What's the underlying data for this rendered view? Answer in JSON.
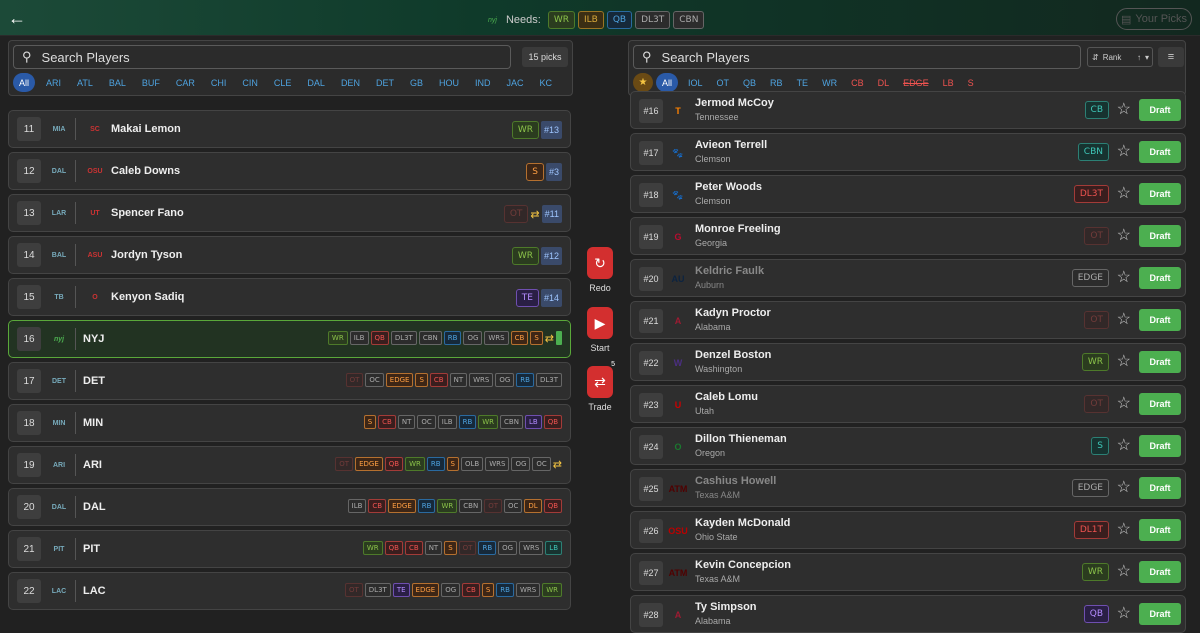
{
  "topbar": {
    "back_icon": "arrow-left-icon",
    "team_logo_text": "nyj",
    "needs_label": "Needs:",
    "needs": [
      {
        "label": "WR",
        "color": "g"
      },
      {
        "label": "ILB",
        "color": "y"
      },
      {
        "label": "QB",
        "color": "b"
      },
      {
        "label": "DL3T",
        "color": "gr"
      },
      {
        "label": "CBN",
        "color": "gr"
      }
    ],
    "your_picks_label": "Your Picks"
  },
  "left": {
    "search_placeholder": "Search Players",
    "picks_count": "15 picks",
    "team_filters": [
      "All",
      "ARI",
      "ATL",
      "BAL",
      "BUF",
      "CAR",
      "CHI",
      "CIN",
      "CLE",
      "DAL",
      "DEN",
      "DET",
      "GB",
      "HOU",
      "IND",
      "JAC",
      "KC"
    ],
    "picks": [
      {
        "num": "11",
        "team_logo": "MIA",
        "college_logo": "SC",
        "player": "Makai Lemon",
        "tags": [
          {
            "label": "WR",
            "color": "g"
          }
        ],
        "rank": "#13"
      },
      {
        "num": "12",
        "team_logo": "DAL",
        "college_logo": "OSU",
        "player": "Caleb Downs",
        "tags": [
          {
            "label": "S",
            "color": "o"
          }
        ],
        "rank": "#3"
      },
      {
        "num": "13",
        "team_logo": "LAR",
        "college_logo": "UT",
        "player": "Spencer Fano",
        "tags": [
          {
            "label": "OT",
            "color": "r",
            "dim": true
          }
        ],
        "rank": "#11",
        "trade": true
      },
      {
        "num": "14",
        "team_logo": "BAL",
        "college_logo": "ASU",
        "player": "Jordyn Tyson",
        "tags": [
          {
            "label": "WR",
            "color": "g"
          }
        ],
        "rank": "#12"
      },
      {
        "num": "15",
        "team_logo": "TB",
        "college_logo": "O",
        "player": "Kenyon Sadiq",
        "tags": [
          {
            "label": "TE",
            "color": "p"
          }
        ],
        "rank": "#14"
      }
    ],
    "current": {
      "num": "16",
      "team": "NYJ",
      "team_logo": "nyj",
      "tags": [
        {
          "label": "WR",
          "color": "g"
        },
        {
          "label": "ILB",
          "color": "gr"
        },
        {
          "label": "QB",
          "color": "r"
        },
        {
          "label": "DL3T",
          "color": "gr"
        },
        {
          "label": "CBN",
          "color": "gr"
        },
        {
          "label": "RB",
          "color": "b"
        },
        {
          "label": "OG",
          "color": "gr"
        },
        {
          "label": "WRS",
          "color": "gr"
        },
        {
          "label": "CB",
          "color": "o"
        },
        {
          "label": "S",
          "color": "o"
        }
      ]
    },
    "upcoming": [
      {
        "num": "17",
        "team": "DET",
        "team_logo": "DET",
        "tags": [
          {
            "label": "OT",
            "color": "r",
            "dim": true
          },
          {
            "label": "OC",
            "color": "gr"
          },
          {
            "label": "EDGE",
            "color": "o"
          },
          {
            "label": "S",
            "color": "o"
          },
          {
            "label": "CB",
            "color": "r"
          },
          {
            "label": "NT",
            "color": "gr"
          },
          {
            "label": "WRS",
            "color": "gr"
          },
          {
            "label": "OG",
            "color": "gr"
          },
          {
            "label": "RB",
            "color": "b"
          },
          {
            "label": "DL3T",
            "color": "gr"
          }
        ]
      },
      {
        "num": "18",
        "team": "MIN",
        "team_logo": "MIN",
        "tags": [
          {
            "label": "S",
            "color": "o"
          },
          {
            "label": "CB",
            "color": "r"
          },
          {
            "label": "NT",
            "color": "gr"
          },
          {
            "label": "OC",
            "color": "gr"
          },
          {
            "label": "ILB",
            "color": "gr"
          },
          {
            "label": "RB",
            "color": "b"
          },
          {
            "label": "WR",
            "color": "g"
          },
          {
            "label": "CBN",
            "color": "gr"
          },
          {
            "label": "LB",
            "color": "p"
          },
          {
            "label": "QB",
            "color": "r"
          }
        ]
      },
      {
        "num": "19",
        "team": "ARI",
        "team_logo": "ARI",
        "tags": [
          {
            "label": "OT",
            "color": "r",
            "dim": true
          },
          {
            "label": "EDGE",
            "color": "o"
          },
          {
            "label": "QB",
            "color": "r"
          },
          {
            "label": "WR",
            "color": "g"
          },
          {
            "label": "RB",
            "color": "b"
          },
          {
            "label": "S",
            "color": "o"
          },
          {
            "label": "OLB",
            "color": "gr"
          },
          {
            "label": "WRS",
            "color": "gr"
          },
          {
            "label": "OG",
            "color": "gr"
          },
          {
            "label": "OC",
            "color": "gr"
          }
        ],
        "trade": true
      },
      {
        "num": "20",
        "team": "DAL",
        "team_logo": "DAL",
        "tags": [
          {
            "label": "ILB",
            "color": "gr"
          },
          {
            "label": "CB",
            "color": "r"
          },
          {
            "label": "EDGE",
            "color": "o"
          },
          {
            "label": "RB",
            "color": "b"
          },
          {
            "label": "WR",
            "color": "g"
          },
          {
            "label": "CBN",
            "color": "gr"
          },
          {
            "label": "OT",
            "color": "r",
            "dim": true
          },
          {
            "label": "OC",
            "color": "gr"
          },
          {
            "label": "DL",
            "color": "o"
          },
          {
            "label": "QB",
            "color": "r"
          }
        ]
      },
      {
        "num": "21",
        "team": "PIT",
        "team_logo": "PIT",
        "tags": [
          {
            "label": "WR",
            "color": "g"
          },
          {
            "label": "QB",
            "color": "r"
          },
          {
            "label": "CB",
            "color": "r"
          },
          {
            "label": "NT",
            "color": "gr"
          },
          {
            "label": "S",
            "color": "o"
          },
          {
            "label": "OT",
            "color": "r",
            "dim": true
          },
          {
            "label": "RB",
            "color": "b"
          },
          {
            "label": "OG",
            "color": "gr"
          },
          {
            "label": "WRS",
            "color": "gr"
          },
          {
            "label": "LB",
            "color": "t"
          }
        ]
      },
      {
        "num": "22",
        "team": "LAC",
        "team_logo": "LAC",
        "tags": [
          {
            "label": "OT",
            "color": "r",
            "dim": true
          },
          {
            "label": "DL3T",
            "color": "gr"
          },
          {
            "label": "TE",
            "color": "p"
          },
          {
            "label": "EDGE",
            "color": "o"
          },
          {
            "label": "OG",
            "color": "gr"
          },
          {
            "label": "CB",
            "color": "r"
          },
          {
            "label": "S",
            "color": "o"
          },
          {
            "label": "RB",
            "color": "b"
          },
          {
            "label": "WRS",
            "color": "gr"
          },
          {
            "label": "WR",
            "color": "g"
          }
        ]
      }
    ]
  },
  "controls": {
    "redo_label": "Redo",
    "start_label": "Start",
    "trade_label": "Trade",
    "trade_badge": "5"
  },
  "right": {
    "search_placeholder": "Search Players",
    "sort_label": "Rank",
    "position_filters": [
      {
        "label": "All",
        "color": "act"
      },
      {
        "label": "IOL",
        "color": "b"
      },
      {
        "label": "OT",
        "color": "b"
      },
      {
        "label": "QB",
        "color": "b"
      },
      {
        "label": "RB",
        "color": "b"
      },
      {
        "label": "TE",
        "color": "b"
      },
      {
        "label": "WR",
        "color": "b"
      },
      {
        "label": "CB",
        "color": "r"
      },
      {
        "label": "DL",
        "color": "r"
      },
      {
        "label": "EDGE",
        "color": "r",
        "strike": true
      },
      {
        "label": "LB",
        "color": "r"
      },
      {
        "label": "S",
        "color": "r"
      }
    ],
    "draft_label": "Draft",
    "players": [
      {
        "rank": "#16",
        "name": "Jermod McCoy",
        "school": "Tennessee",
        "logo": "T",
        "logo_color": "#ff8200",
        "pos": "CB",
        "pos_color": "t"
      },
      {
        "rank": "#17",
        "name": "Avieon Terrell",
        "school": "Clemson",
        "logo": "🐾",
        "logo_color": "#f56600",
        "pos": "CBN",
        "pos_color": "t"
      },
      {
        "rank": "#18",
        "name": "Peter Woods",
        "school": "Clemson",
        "logo": "🐾",
        "logo_color": "#f56600",
        "pos": "DL3T",
        "pos_color": "r"
      },
      {
        "rank": "#19",
        "name": "Monroe Freeling",
        "school": "Georgia",
        "logo": "G",
        "logo_color": "#ba0c2f",
        "pos": "OT",
        "pos_color": "r",
        "pos_dim": true
      },
      {
        "rank": "#20",
        "name": "Keldric Faulk",
        "school": "Auburn",
        "logo": "AU",
        "logo_color": "#0c2340",
        "pos": "EDGE",
        "pos_color": "gr",
        "faded": true
      },
      {
        "rank": "#21",
        "name": "Kadyn Proctor",
        "school": "Alabama",
        "logo": "A",
        "logo_color": "#9e1b32",
        "pos": "OT",
        "pos_color": "r",
        "pos_dim": true
      },
      {
        "rank": "#22",
        "name": "Denzel Boston",
        "school": "Washington",
        "logo": "W",
        "logo_color": "#4b2e83",
        "pos": "WR",
        "pos_color": "g"
      },
      {
        "rank": "#23",
        "name": "Caleb Lomu",
        "school": "Utah",
        "logo": "U",
        "logo_color": "#cc0000",
        "pos": "OT",
        "pos_color": "r",
        "pos_dim": true
      },
      {
        "rank": "#24",
        "name": "Dillon Thieneman",
        "school": "Oregon",
        "logo": "O",
        "logo_color": "#1a7a2e",
        "pos": "S",
        "pos_color": "t"
      },
      {
        "rank": "#25",
        "name": "Cashius Howell",
        "school": "Texas A&M",
        "logo": "ATM",
        "logo_color": "#500000",
        "pos": "EDGE",
        "pos_color": "gr",
        "faded": true
      },
      {
        "rank": "#26",
        "name": "Kayden McDonald",
        "school": "Ohio State",
        "logo": "OSU",
        "logo_color": "#bb0000",
        "pos": "DL1T",
        "pos_color": "r"
      },
      {
        "rank": "#27",
        "name": "Kevin Concepcion",
        "school": "Texas A&M",
        "logo": "ATM",
        "logo_color": "#500000",
        "pos": "WR",
        "pos_color": "g"
      },
      {
        "rank": "#28",
        "name": "Ty Simpson",
        "school": "Alabama",
        "logo": "A",
        "logo_color": "#9e1b32",
        "pos": "QB",
        "pos_color": "p"
      }
    ]
  }
}
